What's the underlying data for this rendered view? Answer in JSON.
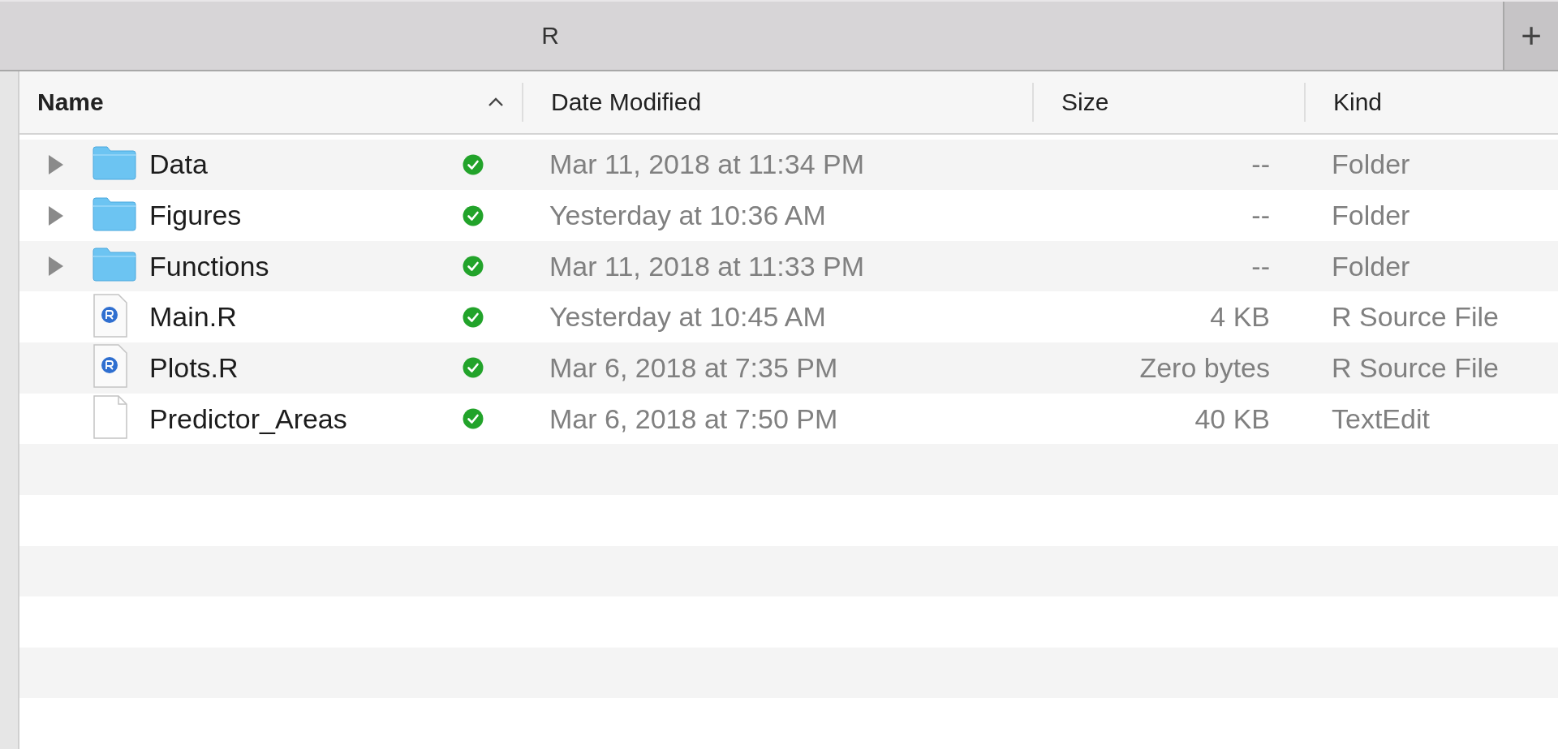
{
  "tabs": [
    {
      "label": "R",
      "selected": true
    }
  ],
  "new_tab_button": {
    "label": "+"
  },
  "table": {
    "columns": [
      {
        "label": "Name",
        "sorted": true
      },
      {
        "label": "Date Modified",
        "sorted": false
      },
      {
        "label": "Size",
        "sorted": false
      },
      {
        "label": "Kind",
        "sorted": false
      }
    ],
    "rows": [
      {
        "kind": "folder",
        "expanded": false,
        "name": "Data",
        "synced": true,
        "date_modified": "Mar 11, 2018 at 11:34 PM",
        "size": "--",
        "type": "Folder"
      },
      {
        "kind": "folder",
        "expanded": false,
        "name": "Figures",
        "synced": true,
        "date_modified": "Yesterday at 10:36 AM",
        "size": "--",
        "type": "Folder"
      },
      {
        "kind": "folder",
        "expanded": false,
        "name": "Functions",
        "synced": true,
        "date_modified": "Mar 11, 2018 at 11:33 PM",
        "size": "--",
        "type": "Folder"
      },
      {
        "kind": "r_file",
        "name": "Main.R",
        "synced": true,
        "date_modified": "Yesterday at 10:45 AM",
        "size": "4 KB",
        "type": "R Source File"
      },
      {
        "kind": "r_file",
        "name": "Plots.R",
        "synced": true,
        "date_modified": "Mar 6, 2018 at 7:35 PM",
        "size": "Zero bytes",
        "type": "R Source File"
      },
      {
        "kind": "text_file",
        "name": "Predictor_Areas",
        "synced": true,
        "date_modified": "Mar 6, 2018 at 7:50 PM",
        "size": "40 KB",
        "type": "TextEdit"
      }
    ]
  }
}
